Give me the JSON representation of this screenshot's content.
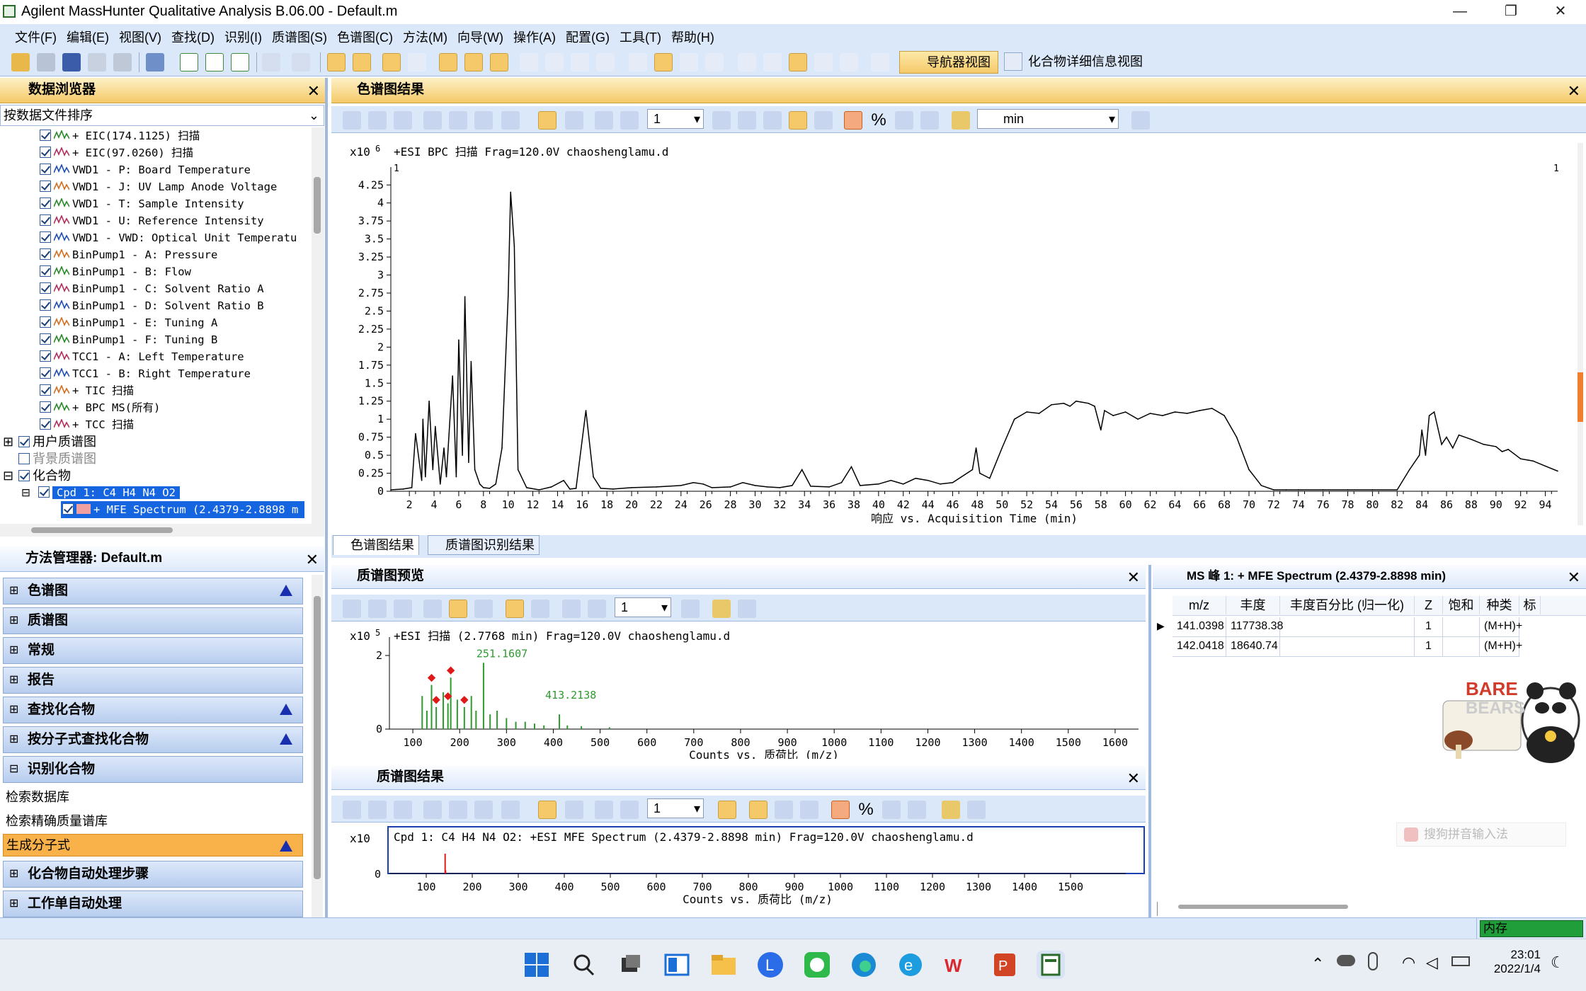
{
  "window": {
    "title": "Agilent MassHunter Qualitative Analysis B.06.00 - Default.m",
    "min": "—",
    "max": "❐",
    "close": "✕"
  },
  "menu": [
    "文件(F)",
    "编辑(E)",
    "视图(V)",
    "查找(D)",
    "识别(I)",
    "质谱图(S)",
    "色谱图(C)",
    "方法(M)",
    "向导(W)",
    "操作(A)",
    "配置(G)",
    "工具(T)",
    "帮助(H)"
  ],
  "toolbar": {
    "navigator_label": "导航器视图",
    "compound_detail_label": "化合物详细信息视图"
  },
  "data_browser": {
    "title": "数据浏览器",
    "sort_label": "按数据文件排序",
    "items": [
      "+ EIC(174.1125) 扫描",
      "+ EIC(97.0260) 扫描",
      "VWD1 - P: Board Temperature",
      "VWD1 - J: UV Lamp Anode Voltage",
      "VWD1 - T: Sample Intensity",
      "VWD1 - U: Reference Intensity",
      "VWD1 - VWD: Optical Unit Temperatu",
      "BinPump1 - A: Pressure",
      "BinPump1 - B: Flow",
      "BinPump1 - C: Solvent Ratio A",
      "BinPump1 - D: Solvent Ratio B",
      "BinPump1 - E: Tuning A",
      "BinPump1 - F: Tuning B",
      "TCC1 - A: Left Temperature",
      "TCC1 - B: Right Temperature",
      "+ TIC 扫描",
      "+ BPC MS(所有)",
      "+ TCC 扫描"
    ],
    "groups": [
      "用户质谱图",
      "背景质谱图",
      "化合物"
    ],
    "compound": "Cpd 1: C4 H4 N4 O2",
    "spectrum": "+ MFE Spectrum (2.4379-2.8898 m"
  },
  "method_manager": {
    "title": "方法管理器: Default.m",
    "sections": [
      "色谱图",
      "质谱图",
      "常规",
      "报告",
      "查找化合物",
      "按分子式查找化合物",
      "识别化合物"
    ],
    "sub_items": [
      "检索数据库",
      "检索精确质量谱库",
      "生成分子式"
    ],
    "sections_after": [
      "化合物自动处理步骤",
      "工作单自动处理"
    ]
  },
  "chromatogram": {
    "title": "色谱图结果",
    "zoom": "1",
    "unit": "min",
    "scale": "x10",
    "exp": "6",
    "header": "+ESI BPC 扫描 Frag=120.0V chaoshenglamu.d",
    "marker_left": "1",
    "marker_right": "1",
    "xlabel": "响应 vs. Acquisition Time (min)",
    "tabs": [
      "色谱图结果",
      "质谱图识别结果"
    ]
  },
  "preview": {
    "title": "质谱图预览",
    "zoom": "1",
    "scale": "x10",
    "exp": "5",
    "header": "+ESI 扫描 (2.7768 min) Frag=120.0V chaoshenglamu.d",
    "labels": [
      "251.1607",
      "413.2138"
    ],
    "xlabel": "Counts vs. 质荷比 (m/z)"
  },
  "spectrum_results": {
    "title": "质谱图结果",
    "zoom": "1",
    "scale": "x10",
    "header": "Cpd 1: C4 H4 N4 O2: +ESI MFE Spectrum (2.4379-2.8898 min) Frag=120.0V chaoshenglamu.d",
    "xlabel": "Counts vs. 质荷比 (m/z)"
  },
  "peaks_panel": {
    "title": "MS 峰 1: + MFE Spectrum (2.4379-2.8898 min)",
    "columns": [
      "m/z",
      "丰度",
      "丰度百分比 (归一化)",
      "Z",
      "饱和",
      "种类",
      "标"
    ],
    "rows": [
      [
        "141.0398",
        "117738.38",
        "",
        "1",
        "",
        "(M+H)+"
      ],
      [
        "142.0418",
        "18640.74",
        "",
        "1",
        "",
        "(M+H)+"
      ]
    ]
  },
  "ime": "搜狗拼音输入法",
  "status": {
    "memory": "内存"
  },
  "clock": {
    "time": "23:01",
    "date": "2022/1/4"
  },
  "chart_data": [
    {
      "type": "line",
      "title": "+ESI BPC 扫描 Frag=120.0V chaoshenglamu.d",
      "xlabel": "响应 vs. Acquisition Time (min)",
      "ylabel": "x10^6",
      "xlim": [
        0.5,
        95
      ],
      "ylim": [
        0,
        4.4
      ],
      "xticks": [
        2,
        4,
        6,
        8,
        10,
        12,
        14,
        16,
        18,
        20,
        22,
        24,
        26,
        28,
        30,
        32,
        34,
        36,
        38,
        40,
        42,
        44,
        46,
        48,
        50,
        52,
        54,
        56,
        58,
        60,
        62,
        64,
        66,
        68,
        70,
        72,
        74,
        76,
        78,
        80,
        82,
        84,
        86,
        88,
        90,
        92,
        94
      ],
      "yticks": [
        0,
        0.25,
        0.5,
        0.75,
        1,
        1.25,
        1.5,
        1.75,
        2,
        2.25,
        2.5,
        2.75,
        3,
        3.25,
        3.5,
        3.75,
        4,
        4.25
      ],
      "x": [
        0.5,
        1.5,
        2.2,
        2.5,
        3.0,
        3.1,
        3.3,
        3.6,
        3.9,
        4.1,
        4.5,
        4.8,
        5.0,
        5.5,
        5.8,
        6.0,
        6.3,
        6.5,
        6.8,
        7.0,
        7.3,
        7.7,
        8.0,
        8.5,
        9.0,
        9.5,
        10.0,
        10.2,
        10.5,
        10.8,
        11.5,
        12.5,
        13.5,
        14.5,
        15.0,
        15.5,
        16.3,
        16.9,
        17.5,
        18.5,
        20,
        22,
        24,
        25,
        25.8,
        26.5,
        28,
        29,
        30,
        31,
        32,
        33,
        33.8,
        34.5,
        36,
        37,
        37.8,
        38.5,
        40,
        41,
        42,
        43,
        44,
        45,
        46,
        47.6,
        47.9,
        48.2,
        49,
        50,
        51,
        52,
        53,
        54,
        55,
        55.5,
        56,
        57,
        57.5,
        58,
        58.3,
        59,
        60,
        61,
        62,
        63,
        64,
        65,
        66,
        67,
        68,
        69,
        70,
        71,
        72,
        73,
        74,
        76,
        78,
        80,
        82,
        83,
        83.8,
        84.0,
        84.3,
        84.6,
        85.0,
        85.6,
        86,
        86.5,
        87,
        88,
        89,
        90,
        90.5,
        91,
        92,
        93,
        94,
        95
      ],
      "y": [
        0.02,
        0.03,
        0.05,
        0.8,
        0.15,
        1.0,
        0.2,
        1.25,
        0.3,
        0.9,
        0.1,
        0.6,
        0.2,
        1.6,
        0.2,
        2.1,
        0.5,
        2.7,
        0.4,
        1.8,
        0.3,
        0.1,
        0.05,
        0.04,
        0.1,
        0.6,
        2.7,
        4.15,
        3.4,
        0.3,
        0.05,
        0.02,
        0.06,
        0.15,
        0.03,
        0.04,
        1.12,
        0.2,
        0.04,
        0.03,
        0.05,
        0.06,
        0.08,
        0.12,
        0.1,
        0.05,
        0.06,
        0.12,
        0.08,
        0.06,
        0.05,
        0.08,
        0.3,
        0.07,
        0.06,
        0.12,
        0.34,
        0.08,
        0.1,
        0.15,
        0.1,
        0.18,
        0.15,
        0.1,
        0.12,
        0.3,
        0.6,
        0.25,
        0.18,
        0.6,
        1.0,
        1.1,
        1.08,
        1.2,
        1.22,
        1.18,
        1.25,
        1.22,
        1.18,
        0.85,
        1.12,
        1.05,
        1.1,
        1.0,
        1.08,
        1.05,
        1.1,
        1.08,
        1.12,
        1.15,
        1.05,
        0.75,
        0.3,
        0.08,
        0.02,
        0.02,
        0.02,
        0.02,
        0.02,
        0.02,
        0.02,
        0.3,
        0.5,
        0.85,
        0.5,
        1.05,
        1.1,
        0.65,
        0.75,
        0.6,
        0.78,
        0.72,
        0.65,
        0.62,
        0.55,
        0.58,
        0.45,
        0.42,
        0.35,
        0.28
      ]
    },
    {
      "type": "bar",
      "title": "+ESI 扫描 (2.7768 min) Frag=120.0V chaoshenglamu.d",
      "xlabel": "Counts vs. 质荷比 (m/z)",
      "ylabel": "x10^5",
      "xlim": [
        50,
        1650
      ],
      "ylim": [
        0,
        2.5
      ],
      "xticks": [
        100,
        200,
        300,
        400,
        500,
        600,
        700,
        800,
        900,
        1000,
        1100,
        1200,
        1300,
        1400,
        1500,
        1600
      ],
      "yticks": [
        0,
        2
      ],
      "x": [
        120,
        130,
        140,
        150,
        165,
        175,
        181,
        195,
        210,
        225,
        235,
        251,
        265,
        280,
        300,
        320,
        340,
        360,
        380,
        413,
        430,
        460,
        520
      ],
      "y": [
        0.9,
        0.5,
        1.2,
        0.6,
        1.0,
        0.7,
        1.4,
        0.8,
        0.6,
        0.9,
        0.5,
        1.8,
        0.4,
        0.5,
        0.3,
        0.2,
        0.2,
        0.15,
        0.1,
        0.4,
        0.1,
        0.08,
        0.05
      ],
      "labels": [
        "251.1607",
        "413.2138"
      ]
    },
    {
      "type": "bar",
      "title": "Cpd 1: C4 H4 N4 O2: +ESI MFE Spectrum (2.4379-2.8898 min) Frag=120.0V chaoshenglamu.d",
      "xlabel": "Counts vs. 质荷比 (m/z)",
      "ylabel": "x10",
      "xlim": [
        20,
        1620
      ],
      "xticks": [
        100,
        200,
        300,
        400,
        500,
        600,
        700,
        800,
        900,
        1000,
        1100,
        1200,
        1300,
        1400,
        1500
      ],
      "yticks": [
        0
      ],
      "x": [
        141.0398,
        142.0418
      ],
      "y": [
        117738.38,
        18640.74
      ]
    }
  ]
}
